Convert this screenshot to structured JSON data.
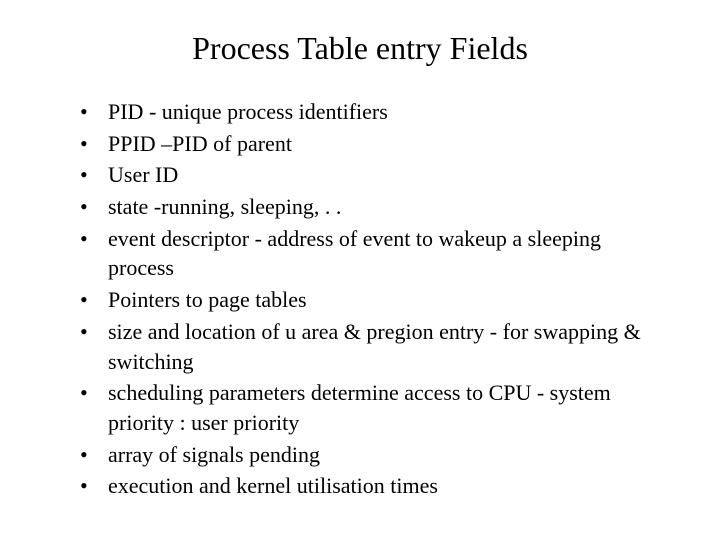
{
  "title": "Process Table entry Fields",
  "items": [
    "PID - unique process identifiers",
    "PPID –PID of parent",
    "User ID",
    "state -running, sleeping, . .",
    "event descriptor - address of event to wakeup a sleeping process",
    "Pointers to page tables",
    "size and location of  u area & pregion entry - for swapping & switching",
    "scheduling parameters determine access to CPU - system priority : user priority",
    "array of signals pending",
    "execution and kernel utilisation times"
  ]
}
